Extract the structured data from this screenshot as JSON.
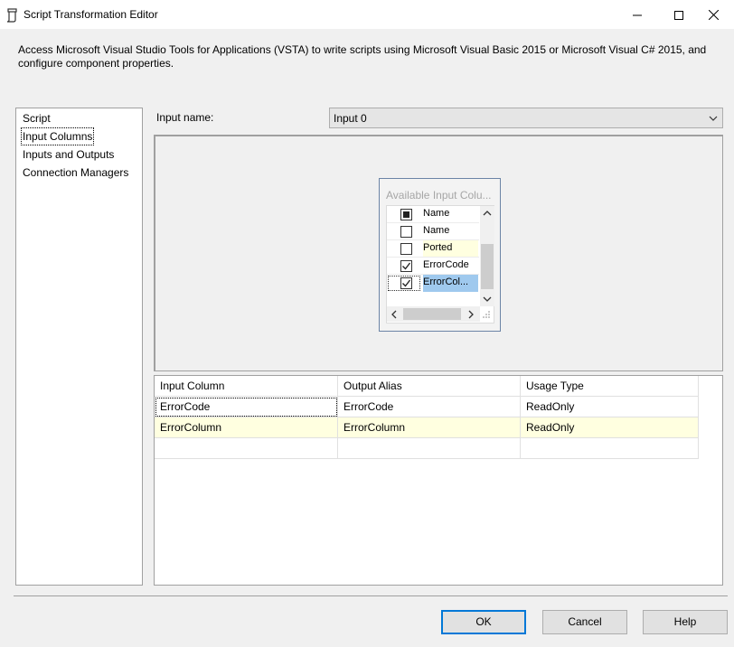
{
  "window": {
    "title": "Script Transformation Editor",
    "controls": {
      "minimize": "minimize-icon",
      "maximize": "maximize-icon",
      "close": "close-icon"
    }
  },
  "description": "Access Microsoft Visual Studio Tools for Applications (VSTA) to write scripts using Microsoft Visual Basic 2015 or Microsoft Visual C# 2015, and configure component properties.",
  "nav": {
    "items": [
      {
        "label": "Script"
      },
      {
        "label": "Input Columns",
        "selected": true
      },
      {
        "label": "Inputs and Outputs"
      },
      {
        "label": "Connection Managers"
      }
    ]
  },
  "input": {
    "label": "Input name:",
    "value": "Input 0"
  },
  "available_columns": {
    "title": "Available Input Colu...",
    "header": "Name",
    "rows": [
      {
        "name": "Name",
        "checked": false
      },
      {
        "name": "Ported",
        "checked": false,
        "highlight": true
      },
      {
        "name": "ErrorCode",
        "checked": true
      },
      {
        "name": "ErrorCol...",
        "checked": true,
        "selected": true
      }
    ]
  },
  "grid": {
    "headers": [
      "Input Column",
      "Output Alias",
      "Usage Type"
    ],
    "rows": [
      [
        "ErrorCode",
        "ErrorCode",
        "ReadOnly"
      ],
      [
        "ErrorColumn",
        "ErrorColumn",
        "ReadOnly"
      ]
    ]
  },
  "buttons": {
    "ok": "OK",
    "cancel": "Cancel",
    "help": "Help"
  },
  "colors": {
    "accent": "#0078d7",
    "highlight_row": "#ffffe0",
    "selected_cell": "#9fc9ee"
  }
}
